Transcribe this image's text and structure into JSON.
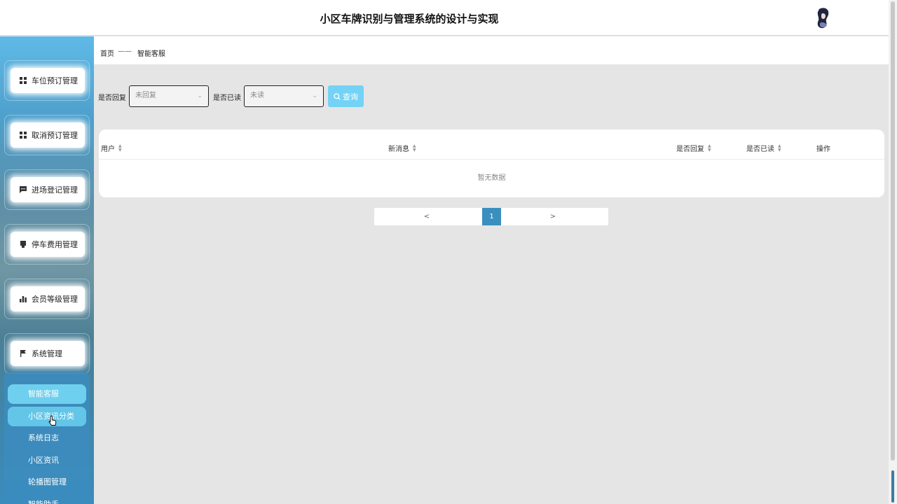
{
  "header": {
    "title": "小区车牌识别与管理系统的设计与实现",
    "avatar_icon": "user-avatar-icon"
  },
  "sidebar": {
    "items": [
      {
        "label": "车位预订管理",
        "icon": "grid-icon"
      },
      {
        "label": "取消预订管理",
        "icon": "grid-icon"
      },
      {
        "label": "进场登记管理",
        "icon": "message-icon"
      },
      {
        "label": "停车费用管理",
        "icon": "card-icon"
      },
      {
        "label": "会员等级管理",
        "icon": "bar-chart-icon"
      },
      {
        "label": "系统管理",
        "icon": "flag-icon"
      }
    ],
    "sub_items": [
      {
        "label": "智能客服",
        "state": "active"
      },
      {
        "label": "小区资讯分类",
        "state": "hover"
      },
      {
        "label": "系统日志",
        "state": "normal"
      },
      {
        "label": "小区资讯",
        "state": "normal"
      },
      {
        "label": "轮播图管理",
        "state": "normal"
      },
      {
        "label": "智能助手",
        "state": "normal"
      }
    ]
  },
  "breadcrumb": {
    "home": "首页",
    "separator": "——",
    "current": "智能客服"
  },
  "filters": {
    "replied_label": "是否回复",
    "replied_value": "未回复",
    "read_label": "是否已读",
    "read_value": "未读",
    "query_button": "查询"
  },
  "table": {
    "columns": [
      "用户",
      "新消息",
      "是否回复",
      "是否已读",
      "操作"
    ],
    "empty_text": "暂无数据"
  },
  "pagination": {
    "prev": "<",
    "current": "1",
    "next": ">"
  },
  "colors": {
    "accent": "#3a8fbe",
    "query_button": "#74d3f5",
    "submenu_active": "#6ed0ee"
  }
}
